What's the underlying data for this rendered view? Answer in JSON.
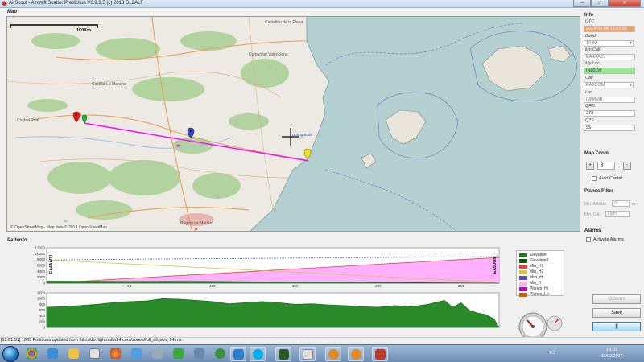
{
  "window": {
    "title": "AirScout - Aircraft Scatter Prediction V0.9.9.5 (c) 2013 DL2ALF",
    "minimize": "—",
    "maximize": "□",
    "close": "✕"
  },
  "map": {
    "section_label": "Map",
    "scale_label": "100Km",
    "attribution": "© OpenStreetMap - Map data © 2014 OpenStreetMap",
    "debug_label": "Debug Build",
    "places": [
      "Castellón de la Plana",
      "Comunitat Valenciana",
      "Castilla-La Mancha",
      "Ciudad Real",
      "Región de Murcia"
    ]
  },
  "info": {
    "section_label": "Info",
    "utc_label": "UTC",
    "utc_value": "2014-02-08 12:02:02",
    "band_label": "Band",
    "band_value": "144M",
    "mycall_label": "My Call",
    "mycall_value": "EA4AADJ",
    "myloc_label": "My Loc",
    "myloc_value": "IN80JW",
    "call_label": "Call",
    "call_value": "EA5DOM",
    "loc_label": "Loc",
    "loc_value": "IM98MR",
    "qrb_label": "QRB",
    "qrb_value": "273",
    "qtf_label": "QTF",
    "qtf_value": "95"
  },
  "map_zoom": {
    "label": "Map Zoom",
    "plus": "+",
    "minus": "-",
    "value": "8",
    "auto_center": "Auto Center"
  },
  "planes_filter": {
    "label": "Planes Filter",
    "min_altitude_label": "Min. Altitude",
    "min_altitude_value": "0",
    "min_altitude_unit": "m",
    "min_cat_label": "Min. Cat",
    "min_cat_value": "Light"
  },
  "alarms": {
    "label": "Alarms",
    "activate": "Activate Alarms"
  },
  "buttons": {
    "options": "Options",
    "save": "Save",
    "pause": "||"
  },
  "pathinfo": {
    "section_label": "Pathinfo",
    "left_call": "EA4AADJ",
    "right_call": "EA5DOM",
    "legend": [
      {
        "name": "Elevation",
        "color": "#1f7a1f"
      },
      {
        "name": "Elevation2",
        "color": "#0a5c0a"
      },
      {
        "name": "Min_H1",
        "color": "#e04040"
      },
      {
        "name": "Min_H2",
        "color": "#e0c040"
      },
      {
        "name": "Max_H",
        "color": "#5050c0"
      },
      {
        "name": "Min_H",
        "color": "#ffb0ff"
      },
      {
        "name": "Planes_Hi",
        "color": "#c000c0"
      },
      {
        "name": "Planes_Lo",
        "color": "#c06000"
      }
    ]
  },
  "chart_data": [
    {
      "type": "area",
      "title": "",
      "xlabel": "",
      "ylabel": "",
      "x": [
        0,
        25,
        50,
        75,
        100,
        125,
        150,
        175,
        200,
        225,
        250,
        273
      ],
      "xlim": [
        0,
        273
      ],
      "ylim": [
        0,
        12000
      ],
      "x_ticks": [
        "50",
        "100",
        "150",
        "200",
        "250"
      ],
      "y_ticks": [
        "12000",
        "10000",
        "8000",
        "6000",
        "4000",
        "2000",
        "0"
      ],
      "series": [
        {
          "name": "Max_H",
          "values": [
            7800,
            8000,
            8100,
            8200,
            8300,
            8400,
            8500,
            8600,
            8700,
            8800,
            8900,
            9000
          ]
        },
        {
          "name": "Min_H",
          "values": [
            0,
            700,
            1500,
            2300,
            3100,
            3900,
            4700,
            5500,
            6300,
            7100,
            7900,
            8600
          ]
        },
        {
          "name": "Min_H1",
          "values": [
            0,
            800,
            1600,
            2400,
            3200,
            4000,
            4800,
            5600,
            6400,
            7200,
            8000,
            8700
          ]
        },
        {
          "name": "Min_H2",
          "values": [
            7900,
            7200,
            6500,
            5800,
            5100,
            4400,
            3700,
            3000,
            2300,
            1600,
            900,
            0
          ]
        },
        {
          "name": "Elevation",
          "values": [
            700,
            650,
            600,
            650,
            600,
            500,
            450,
            400,
            300,
            200,
            100,
            0
          ]
        }
      ]
    },
    {
      "type": "area",
      "title": "",
      "xlabel": "",
      "ylabel": "",
      "xlim": [
        0,
        273
      ],
      "ylim": [
        0,
        1200
      ],
      "x_ticks": [
        "50",
        "100",
        "150",
        "200",
        "250"
      ],
      "y_ticks": [
        "1200",
        "1000",
        "800",
        "600",
        "400",
        "200",
        "0"
      ],
      "series": [
        {
          "name": "Elevation",
          "x": [
            0,
            10,
            20,
            30,
            40,
            50,
            60,
            70,
            80,
            90,
            100,
            110,
            120,
            130,
            140,
            150,
            160,
            170,
            180,
            190,
            200,
            210,
            220,
            230,
            240,
            245,
            250,
            255,
            260,
            265,
            270,
            273
          ],
          "values": [
            700,
            720,
            760,
            800,
            860,
            900,
            920,
            1000,
            980,
            940,
            900,
            820,
            860,
            900,
            860,
            800,
            820,
            780,
            760,
            720,
            700,
            760,
            720,
            800,
            940,
            700,
            860,
            600,
            500,
            450,
            300,
            0
          ]
        }
      ]
    }
  ],
  "status": {
    "text": "[12:01:51] 1603 Positions updated from http://db.flightradar24.com/zones/full_all.json, 14 ms."
  },
  "taskbar": {
    "time": "13:02",
    "date": "08/02/2014",
    "lang": "ES"
  }
}
